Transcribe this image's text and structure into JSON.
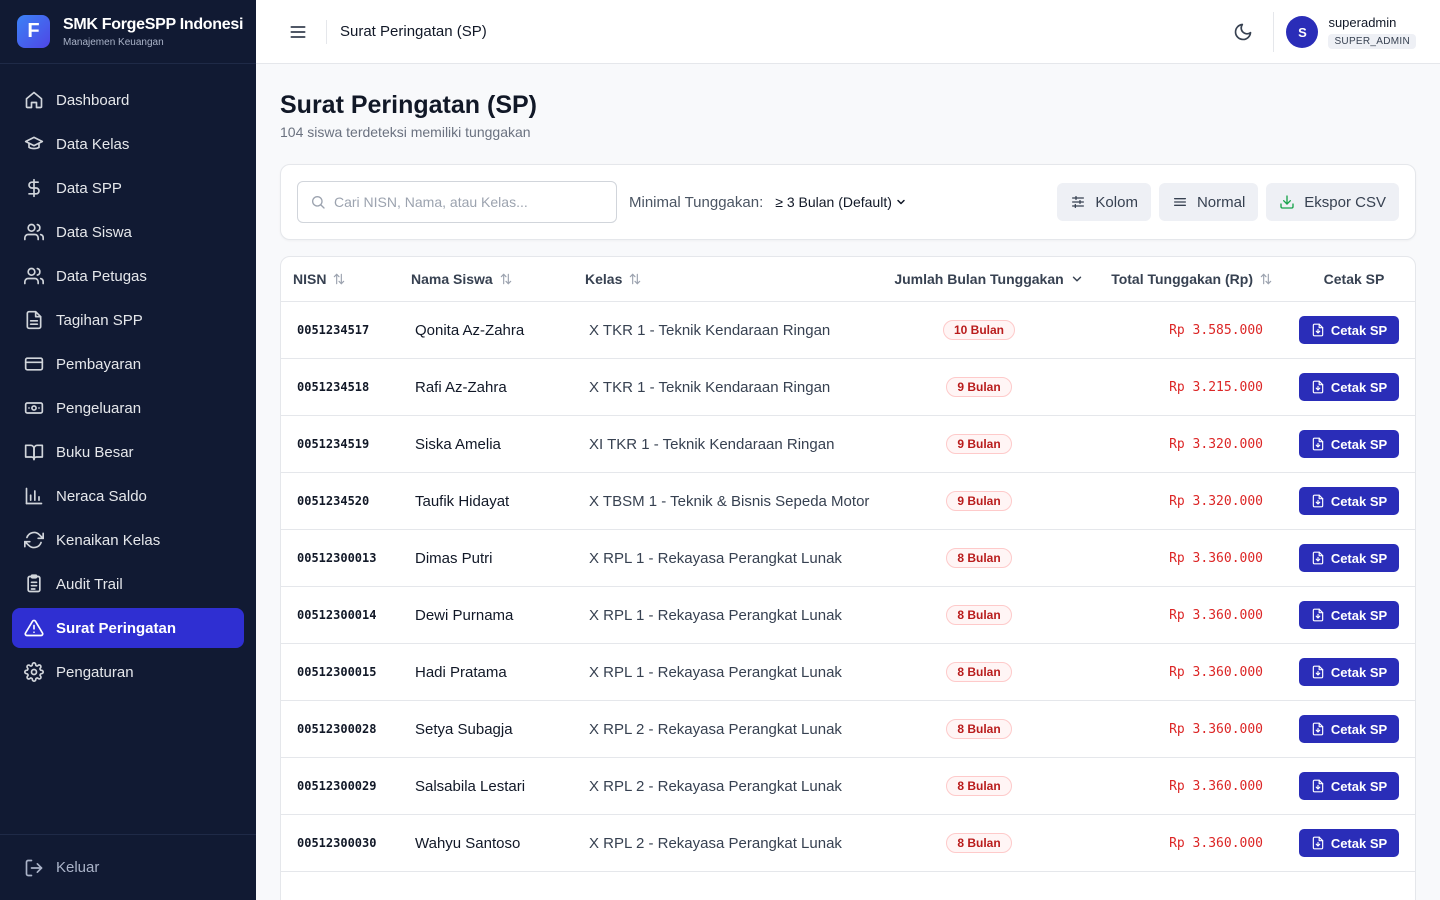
{
  "brand": {
    "title": "SMK ForgeSPP Indonesi",
    "subtitle": "Manajemen Keuangan",
    "logo_letter": "F"
  },
  "sidebar": {
    "items": [
      {
        "label": "Dashboard",
        "icon": "home-icon"
      },
      {
        "label": "Data Kelas",
        "icon": "graduation-cap-icon"
      },
      {
        "label": "Data SPP",
        "icon": "dollar-icon"
      },
      {
        "label": "Data Siswa",
        "icon": "users-icon"
      },
      {
        "label": "Data Petugas",
        "icon": "users-icon"
      },
      {
        "label": "Tagihan SPP",
        "icon": "file-text-icon"
      },
      {
        "label": "Pembayaran",
        "icon": "credit-card-icon"
      },
      {
        "label": "Pengeluaran",
        "icon": "banknote-icon"
      },
      {
        "label": "Buku Besar",
        "icon": "book-icon"
      },
      {
        "label": "Neraca Saldo",
        "icon": "bar-chart-icon"
      },
      {
        "label": "Kenaikan Kelas",
        "icon": "refresh-icon"
      },
      {
        "label": "Audit Trail",
        "icon": "clipboard-list-icon"
      },
      {
        "label": "Surat Peringatan",
        "icon": "alert-triangle-icon",
        "active": true
      },
      {
        "label": "Pengaturan",
        "icon": "gear-icon"
      }
    ],
    "logout_label": "Keluar"
  },
  "topbar": {
    "title": "Surat Peringatan (SP)",
    "user_name": "superadmin",
    "user_role": "SUPER_ADMIN",
    "avatar_letter": "S"
  },
  "page": {
    "title": "Surat Peringatan (SP)",
    "subtitle": "104 siswa terdeteksi memiliki tunggakan"
  },
  "filters": {
    "search_placeholder": "Cari NISN, Nama, atau Kelas...",
    "min_label": "Minimal Tunggakan:",
    "min_value": "≥ 3 Bulan (Default)",
    "btn_kolom": "Kolom",
    "btn_normal": "Normal",
    "btn_ekspor": "Ekspor CSV"
  },
  "table": {
    "headers": {
      "nisn": "NISN",
      "nama": "Nama Siswa",
      "kelas": "Kelas",
      "bulan": "Jumlah Bulan Tunggakan",
      "total": "Total Tunggakan (Rp)",
      "cetak": "Cetak SP"
    },
    "cetak_label": "Cetak SP",
    "rows": [
      {
        "nisn": "0051234517",
        "nama": "Qonita Az-Zahra",
        "kelas": "X TKR 1 - Teknik Kendaraan Ringan",
        "bulan": "10 Bulan",
        "total": "Rp 3.585.000"
      },
      {
        "nisn": "0051234518",
        "nama": "Rafi Az-Zahra",
        "kelas": "X TKR 1 - Teknik Kendaraan Ringan",
        "bulan": "9 Bulan",
        "total": "Rp 3.215.000"
      },
      {
        "nisn": "0051234519",
        "nama": "Siska Amelia",
        "kelas": "XI TKR 1 - Teknik Kendaraan Ringan",
        "bulan": "9 Bulan",
        "total": "Rp 3.320.000"
      },
      {
        "nisn": "0051234520",
        "nama": "Taufik Hidayat",
        "kelas": "X TBSM 1 - Teknik & Bisnis Sepeda Motor",
        "bulan": "9 Bulan",
        "total": "Rp 3.320.000"
      },
      {
        "nisn": "00512300013",
        "nama": "Dimas Putri",
        "kelas": "X RPL 1 - Rekayasa Perangkat Lunak",
        "bulan": "8 Bulan",
        "total": "Rp 3.360.000"
      },
      {
        "nisn": "00512300014",
        "nama": "Dewi Purnama",
        "kelas": "X RPL 1 - Rekayasa Perangkat Lunak",
        "bulan": "8 Bulan",
        "total": "Rp 3.360.000"
      },
      {
        "nisn": "00512300015",
        "nama": "Hadi Pratama",
        "kelas": "X RPL 1 - Rekayasa Perangkat Lunak",
        "bulan": "8 Bulan",
        "total": "Rp 3.360.000"
      },
      {
        "nisn": "00512300028",
        "nama": "Setya Subagja",
        "kelas": "X RPL 2 - Rekayasa Perangkat Lunak",
        "bulan": "8 Bulan",
        "total": "Rp 3.360.000"
      },
      {
        "nisn": "00512300029",
        "nama": "Salsabila Lestari",
        "kelas": "X RPL 2 - Rekayasa Perangkat Lunak",
        "bulan": "8 Bulan",
        "total": "Rp 3.360.000"
      },
      {
        "nisn": "00512300030",
        "nama": "Wahyu Santoso",
        "kelas": "X RPL 2 - Rekayasa Perangkat Lunak",
        "bulan": "8 Bulan",
        "total": "Rp 3.360.000"
      }
    ]
  },
  "colors": {
    "sidebar_bg": "#111a33",
    "accent": "#2a2db8",
    "active_nav": "#2f2fd2",
    "danger": "#dc2626"
  }
}
